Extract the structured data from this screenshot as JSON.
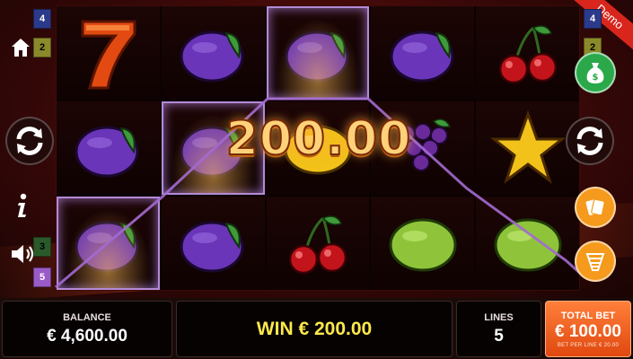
{
  "ribbon": {
    "label": "Demo"
  },
  "win_display": {
    "amount": "200.00"
  },
  "line_indicators": {
    "left": [
      {
        "label": "4",
        "color": "#2b3a8a",
        "text": "#ffffff"
      },
      {
        "label": "2",
        "color": "#8a8a2a",
        "text": "#000000"
      },
      {
        "label": "3",
        "color": "#2a5a2a",
        "text": "#000000"
      },
      {
        "label": "5",
        "color": "#9a5ac8",
        "text": "#ffffff"
      }
    ],
    "right": [
      {
        "label": "4",
        "color": "#2b3a8a",
        "text": "#ffffff"
      },
      {
        "label": "2",
        "color": "#8a8a2a",
        "text": "#000000"
      }
    ]
  },
  "reels": [
    [
      "seven",
      "plum",
      "plum"
    ],
    [
      "plum",
      "plum",
      "plum"
    ],
    [
      "plum",
      "lemon",
      "cherry"
    ],
    [
      "plum",
      "grapes",
      "lime"
    ],
    [
      "cherry",
      "star",
      "lime"
    ]
  ],
  "winning_cells": [
    [
      0,
      2
    ],
    [
      1,
      1
    ],
    [
      2,
      0
    ]
  ],
  "colors": {
    "plum": "#6a35b8",
    "cherry": "#c3141c",
    "lime": "#8fc43a",
    "payline": "#a36ad0",
    "win_text": "#ffe94a",
    "bet_panel": "#ff7f3a"
  },
  "icons": {
    "home": "home-icon",
    "info": "info-icon",
    "sound": "speaker-icon",
    "spin": "spin-arrows-icon",
    "buy_bonus": "money-bag-icon",
    "gamble": "playing-cards-icon",
    "autoplay": "stack-icon"
  },
  "bottom_bar": {
    "balance_label": "BALANCE",
    "balance_value": "€ 4,600.00",
    "win_text": "WIN € 200.00",
    "lines_label": "LINES",
    "lines_value": "5",
    "total_bet_label": "TOTAL BET",
    "total_bet_value": "€ 100.00",
    "bet_per_line": "BET PER LINE € 20.00"
  }
}
